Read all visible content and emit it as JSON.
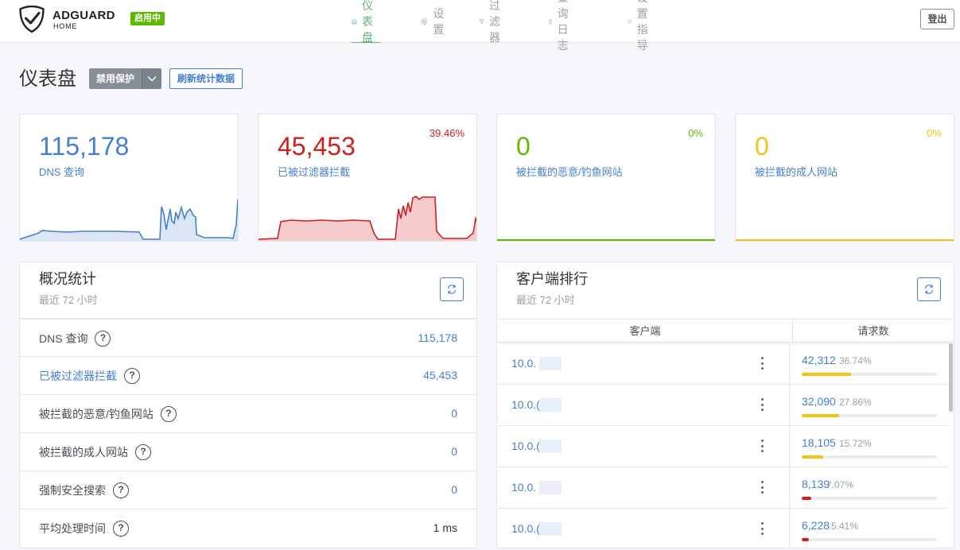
{
  "header": {
    "brand": "ADGUARD",
    "brand_sub": "HOME",
    "status": "启用中",
    "nav": [
      {
        "label": "仪表盘",
        "icon": "home-icon",
        "active": true
      },
      {
        "label": "设置",
        "icon": "gear-icon",
        "active": false
      },
      {
        "label": "过滤器",
        "icon": "filter-icon",
        "active": false
      },
      {
        "label": "查询日志",
        "icon": "document-icon",
        "active": false
      },
      {
        "label": "设置指导",
        "icon": "help-circle-icon",
        "active": false
      }
    ],
    "logout": "登出"
  },
  "page": {
    "title": "仪表盘",
    "disable_protection": "禁用保护",
    "refresh_stats": "刷新统计数据"
  },
  "stat_cards": [
    {
      "value": "115,178",
      "label": "DNS 查询",
      "percent": "",
      "color": "#467fcf"
    },
    {
      "value": "45,453",
      "label": "已被过滤器拦截",
      "percent": "39.46%",
      "color": "#cd201f"
    },
    {
      "value": "0",
      "label": "被拦截的恶意/钓鱼网站",
      "percent": "0%",
      "color": "#5eba00"
    },
    {
      "value": "0",
      "label": "被拦截的成人网站",
      "percent": "0%",
      "color": "#f1c40f"
    }
  ],
  "general": {
    "title": "概况统计",
    "subtitle": "最近 72 小时",
    "rows": [
      {
        "label": "DNS 查询",
        "value": "115,178"
      },
      {
        "label": "已被过滤器拦截",
        "value": "45,453"
      },
      {
        "label": "被拦截的恶意/钓鱼网站",
        "value": "0"
      },
      {
        "label": "被拦截的成人网站",
        "value": "0"
      },
      {
        "label": "强制安全搜索",
        "value": "0"
      },
      {
        "label": "平均处理时间",
        "value": "1 ms"
      }
    ]
  },
  "clients": {
    "title": "客户端排行",
    "subtitle": "最近 72 小时",
    "col_client": "客户端",
    "col_requests": "请求数",
    "rows": [
      {
        "ip": "10.0.",
        "count": "42,312",
        "percent": "36.74%",
        "fill": 0.3674,
        "color": "#f1c40f"
      },
      {
        "ip": "10.0.(",
        "count": "32,090",
        "percent": "27.86%",
        "fill": 0.2786,
        "color": "#f1c40f"
      },
      {
        "ip": "10.0.(",
        "count": "18,105",
        "percent": "15.72%",
        "fill": 0.1572,
        "color": "#f1c40f"
      },
      {
        "ip": "10.0.",
        "count": "8,139",
        "percent": "7.07%",
        "fill": 0.0707,
        "color": "#cd201f"
      },
      {
        "ip": "10.0.(",
        "count": "6,228",
        "percent": "5.41%",
        "fill": 0.0541,
        "color": "#cd201f"
      }
    ]
  },
  "help_glyph": "?"
}
